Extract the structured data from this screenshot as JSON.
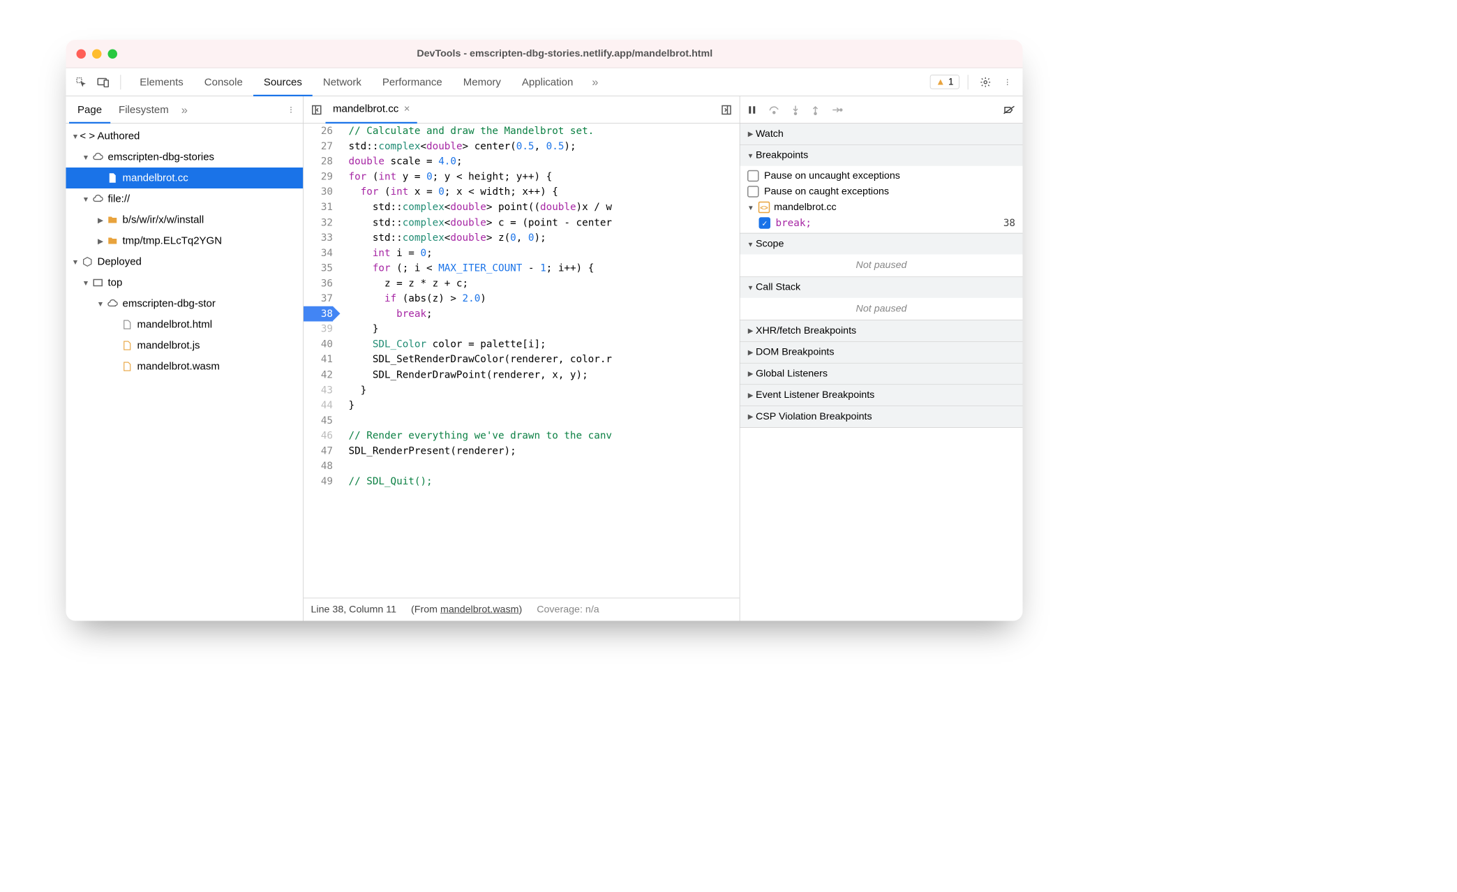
{
  "window_title": "DevTools - emscripten-dbg-stories.netlify.app/mandelbrot.html",
  "panels": [
    "Elements",
    "Console",
    "Sources",
    "Network",
    "Performance",
    "Memory",
    "Application"
  ],
  "active_panel": "Sources",
  "warning_count": "1",
  "navigator": {
    "tabs": [
      "Page",
      "Filesystem"
    ],
    "active": "Page",
    "tree": {
      "authored": "Authored",
      "domain1": "emscripten-dbg-stories",
      "file_selected": "mandelbrot.cc",
      "file_scheme": "file://",
      "folder1": "b/s/w/ir/x/w/install",
      "folder2": "tmp/tmp.ELcTq2YGN",
      "deployed": "Deployed",
      "top": "top",
      "domain2": "emscripten-dbg-stor",
      "f_html": "mandelbrot.html",
      "f_js": "mandelbrot.js",
      "f_wasm": "mandelbrot.wasm"
    }
  },
  "editor": {
    "tab": "mandelbrot.cc",
    "lines": [
      {
        "n": 26,
        "html": "<span class='c-comment'>// Calculate and draw the Mandelbrot set.</span>"
      },
      {
        "n": 27,
        "html": "std::<span class='c-type'>complex</span>&lt;<span class='c-kw'>double</span>&gt; center(<span class='c-num'>0.5</span>, <span class='c-num'>0.5</span>);"
      },
      {
        "n": 28,
        "html": "<span class='c-kw'>double</span> scale = <span class='c-num'>4.0</span>;"
      },
      {
        "n": 29,
        "html": "<span class='c-kw'>for</span> (<span class='c-kw'>int</span> y = <span class='c-num'>0</span>; y &lt; height; y++) {"
      },
      {
        "n": 30,
        "html": "  <span class='c-kw'>for</span> (<span class='c-kw'>int</span> x = <span class='c-num'>0</span>; x &lt; width; x++) {"
      },
      {
        "n": 31,
        "html": "    std::<span class='c-type'>complex</span>&lt;<span class='c-kw'>double</span>&gt; point((<span class='c-kw'>double</span>)x / w"
      },
      {
        "n": 32,
        "html": "    std::<span class='c-type'>complex</span>&lt;<span class='c-kw'>double</span>&gt; c = (point - center"
      },
      {
        "n": 33,
        "html": "    std::<span class='c-type'>complex</span>&lt;<span class='c-kw'>double</span>&gt; z(<span class='c-num'>0</span>, <span class='c-num'>0</span>);"
      },
      {
        "n": 34,
        "html": "    <span class='c-kw'>int</span> i = <span class='c-num'>0</span>;"
      },
      {
        "n": 35,
        "html": "    <span class='c-kw'>for</span> (; i &lt; <span class='c-const'>MAX_ITER_COUNT</span> - <span class='c-num'>1</span>; i++) {"
      },
      {
        "n": 36,
        "html": "      z = z * z + c;"
      },
      {
        "n": 37,
        "html": "      <span class='c-kw'>if</span> (abs(z) &gt; <span class='c-num'>2.0</span>)"
      },
      {
        "n": 38,
        "html": "        <span class='c-kw'>break</span>;",
        "bp": true
      },
      {
        "n": 39,
        "html": "    }",
        "dim": true
      },
      {
        "n": 40,
        "html": "    <span class='c-type'>SDL_Color</span> color = palette[i];"
      },
      {
        "n": 41,
        "html": "    SDL_SetRenderDrawColor(renderer, color.r"
      },
      {
        "n": 42,
        "html": "    SDL_RenderDrawPoint(renderer, x, y);"
      },
      {
        "n": 43,
        "html": "  }",
        "dim": true
      },
      {
        "n": 44,
        "html": "}",
        "dim": true
      },
      {
        "n": 45,
        "html": ""
      },
      {
        "n": 46,
        "html": "<span class='c-comment'>// Render everything we've drawn to the canv</span>",
        "dim": true
      },
      {
        "n": 47,
        "html": "SDL_RenderPresent(renderer);"
      },
      {
        "n": 48,
        "html": ""
      },
      {
        "n": 49,
        "html": "<span class='c-comment'>// SDL_Quit();</span>"
      }
    ]
  },
  "status": {
    "pos": "Line 38, Column 11",
    "from_label": "(From ",
    "from_file": "mandelbrot.wasm",
    "coverage": "Coverage: n/a"
  },
  "debug": {
    "watch": "Watch",
    "breakpoints": "Breakpoints",
    "pause_uncaught": "Pause on uncaught exceptions",
    "pause_caught": "Pause on caught exceptions",
    "bp_file": "mandelbrot.cc",
    "bp_code": "break;",
    "bp_line": "38",
    "scope": "Scope",
    "not_paused": "Not paused",
    "callstack": "Call Stack",
    "xhr": "XHR/fetch Breakpoints",
    "dom": "DOM Breakpoints",
    "global": "Global Listeners",
    "event": "Event Listener Breakpoints",
    "csp": "CSP Violation Breakpoints"
  }
}
